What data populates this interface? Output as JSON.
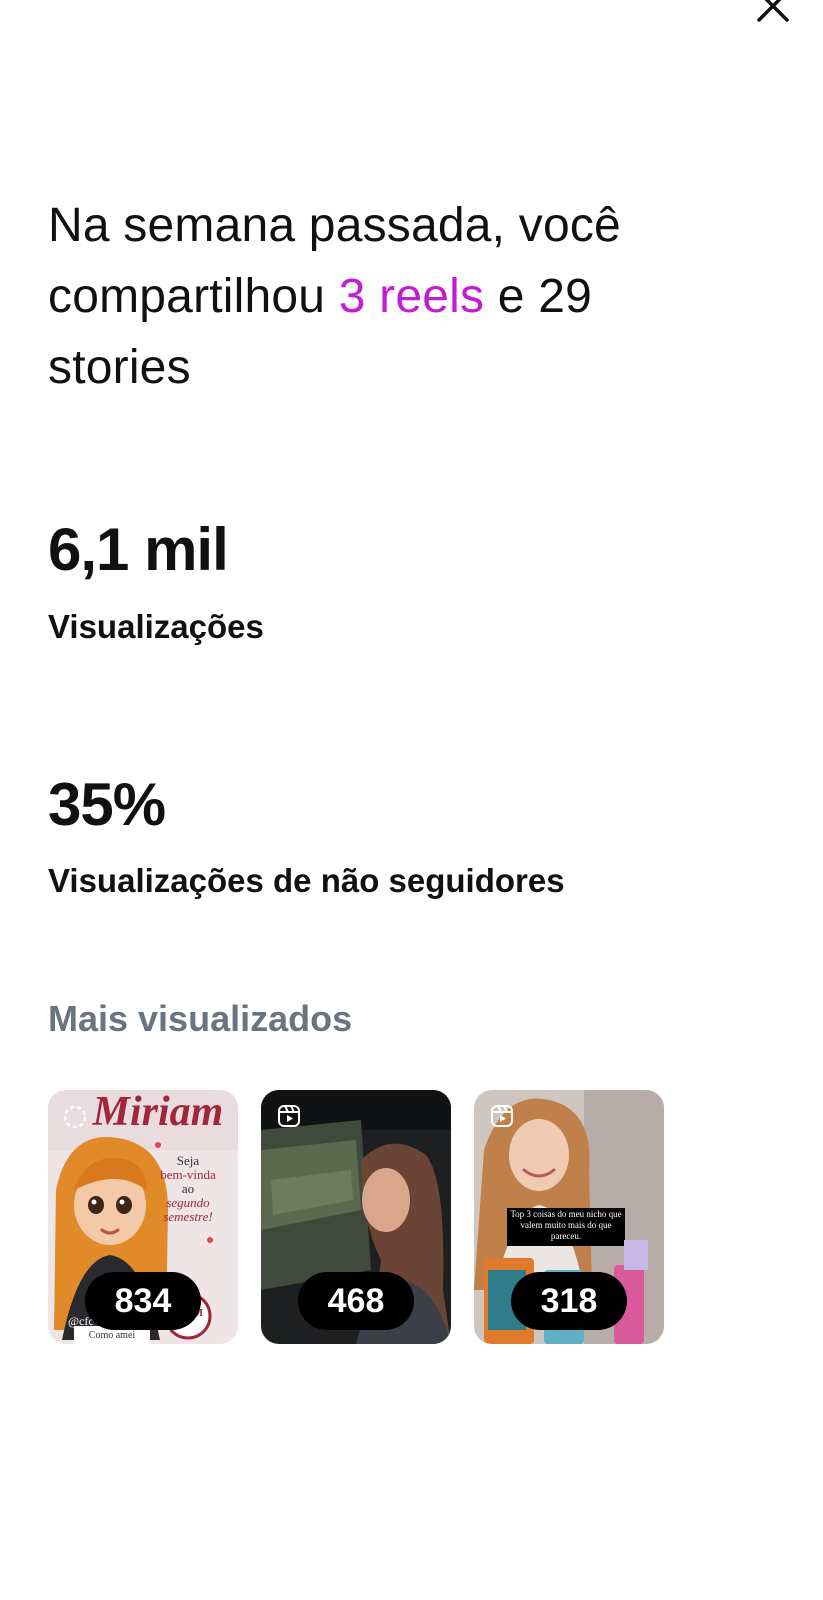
{
  "header": {
    "close_icon": "close-icon"
  },
  "headline": {
    "part1": "Na semana passada, você compartilhou ",
    "accent": "3 reels",
    "part2": " e 29 stories",
    "accent_color": "#c21cd6"
  },
  "metrics": [
    {
      "value": "6,1 mil",
      "label": "Visualizações"
    },
    {
      "value": "35%",
      "label": "Visualizações de não seguidores"
    }
  ],
  "most_viewed": {
    "title": "Mais visualizados",
    "items": [
      {
        "count": "834",
        "type": "story",
        "texts": {
          "name": "Miriam",
          "line1": "Seja",
          "line2": "bem-vinda",
          "line3": "ao",
          "line4": "segundo",
          "line5": "semestre!",
          "handle": "@cfc",
          "seal": "CFCM",
          "footer": "Como amei"
        }
      },
      {
        "count": "468",
        "type": "reel",
        "icon": "reels-icon"
      },
      {
        "count": "318",
        "type": "reel",
        "icon": "reels-icon",
        "caption": "Top 3 coisas do meu nicho que valem muito mais do que pareceu."
      }
    ]
  }
}
